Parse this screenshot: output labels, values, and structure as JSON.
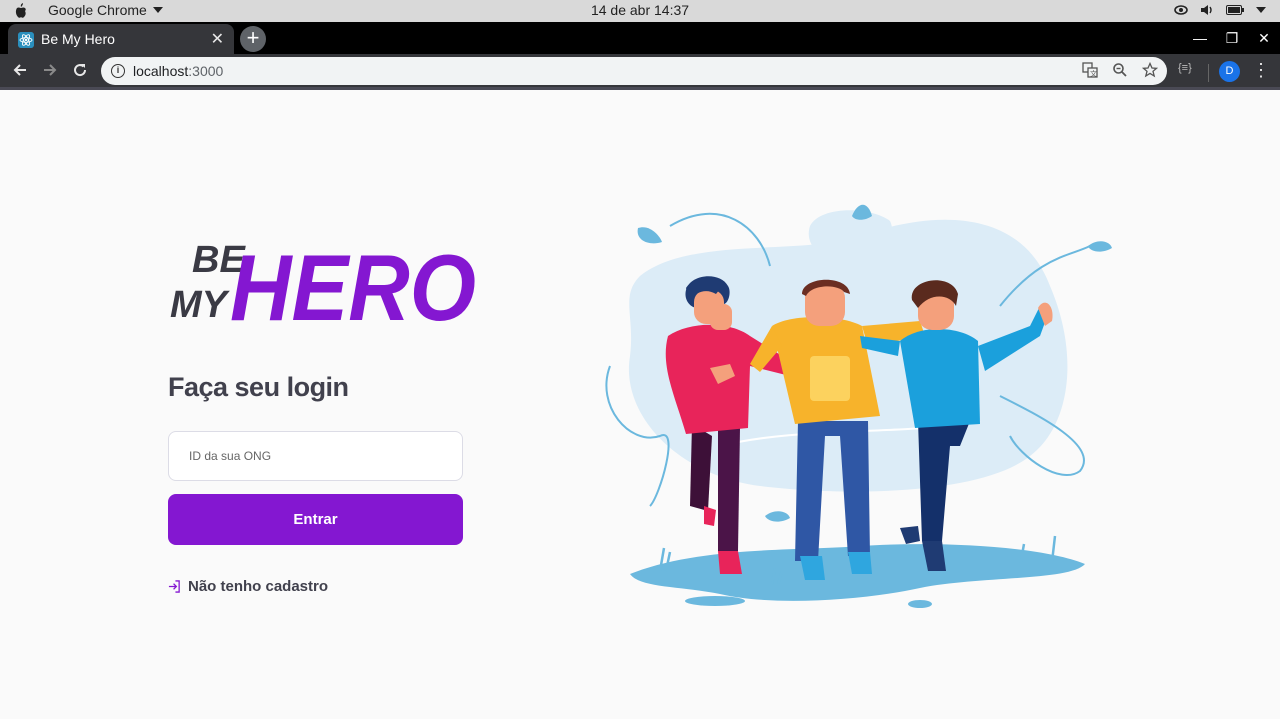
{
  "os": {
    "app_name": "Google Chrome",
    "clock": "14 de abr  14:37"
  },
  "browser": {
    "tab_title": "Be My Hero",
    "url_host": "localhost",
    "url_port": ":3000",
    "profile_initial": "D",
    "extension_label": "{≡}"
  },
  "login": {
    "logo_be": "BE",
    "logo_my": "MY",
    "logo_hero": "HERO",
    "title": "Faça seu login",
    "id_placeholder": "ID da sua ONG",
    "id_value": "",
    "submit_label": "Entrar",
    "register_label": "Não tenho cadastro"
  },
  "colors": {
    "brand_purple": "#8417d1",
    "text_dark": "#41414d",
    "logo_dark": "#3a3a44",
    "background": "#fafafa"
  },
  "icons": {
    "apple": "apple-icon",
    "tab_favicon": "react-favicon-icon",
    "back": "arrow-left-icon",
    "forward": "arrow-right-icon",
    "reload": "reload-icon",
    "info": "info-icon",
    "translate": "translate-icon",
    "zoom": "zoom-icon",
    "bookmark": "star-icon",
    "menu": "kebab-menu-icon",
    "register": "log-in-icon"
  }
}
